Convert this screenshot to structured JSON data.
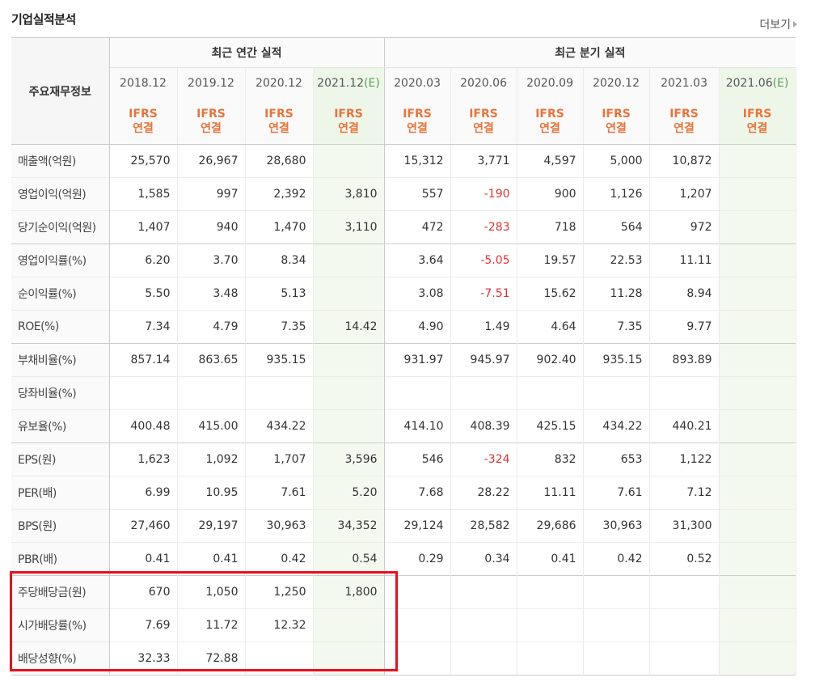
{
  "header": {
    "title": "기업실적분석",
    "more_label": "더보기"
  },
  "table": {
    "corner_label": "주요재무정보",
    "annual_label": "최근 연간 실적",
    "quarterly_label": "최근 분기 실적",
    "periods": [
      {
        "label": "2018.12",
        "e": "",
        "group": "annual",
        "forecast": false
      },
      {
        "label": "2019.12",
        "e": "",
        "group": "annual",
        "forecast": false
      },
      {
        "label": "2020.12",
        "e": "",
        "group": "annual",
        "forecast": false
      },
      {
        "label": "2021.12",
        "e": "(E)",
        "group": "annual",
        "forecast": true
      },
      {
        "label": "2020.03",
        "e": "",
        "group": "quarter",
        "forecast": false
      },
      {
        "label": "2020.06",
        "e": "",
        "group": "quarter",
        "forecast": false
      },
      {
        "label": "2020.09",
        "e": "",
        "group": "quarter",
        "forecast": false
      },
      {
        "label": "2020.12",
        "e": "",
        "group": "quarter",
        "forecast": false
      },
      {
        "label": "2021.03",
        "e": "",
        "group": "quarter",
        "forecast": false
      },
      {
        "label": "2021.06",
        "e": "(E)",
        "group": "quarter",
        "forecast": true
      }
    ],
    "ifrs_line1": "IFRS",
    "ifrs_line2": "연결",
    "rows": [
      {
        "label": "매출액(억원)",
        "values": [
          "25,570",
          "26,967",
          "28,680",
          "",
          "15,312",
          "3,771",
          "4,597",
          "5,000",
          "10,872",
          ""
        ],
        "sep": true
      },
      {
        "label": "영업이익(억원)",
        "values": [
          "1,585",
          "997",
          "2,392",
          "3,810",
          "557",
          "-190",
          "900",
          "1,126",
          "1,207",
          ""
        ]
      },
      {
        "label": "당기순이익(억원)",
        "values": [
          "1,407",
          "940",
          "1,470",
          "3,110",
          "472",
          "-283",
          "718",
          "564",
          "972",
          ""
        ]
      },
      {
        "label": "영업이익률(%)",
        "values": [
          "6.20",
          "3.70",
          "8.34",
          "",
          "3.64",
          "-5.05",
          "19.57",
          "22.53",
          "11.11",
          ""
        ],
        "sep": true
      },
      {
        "label": "순이익률(%)",
        "values": [
          "5.50",
          "3.48",
          "5.13",
          "",
          "3.08",
          "-7.51",
          "15.62",
          "11.28",
          "8.94",
          ""
        ]
      },
      {
        "label": "ROE(%)",
        "values": [
          "7.34",
          "4.79",
          "7.35",
          "14.42",
          "4.90",
          "1.49",
          "4.64",
          "7.35",
          "9.77",
          ""
        ]
      },
      {
        "label": "부채비율(%)",
        "values": [
          "857.14",
          "863.65",
          "935.15",
          "",
          "931.97",
          "945.97",
          "902.40",
          "935.15",
          "893.89",
          ""
        ],
        "sep": true
      },
      {
        "label": "당좌비율(%)",
        "values": [
          "",
          "",
          "",
          "",
          "",
          "",
          "",
          "",
          "",
          ""
        ]
      },
      {
        "label": "유보율(%)",
        "values": [
          "400.48",
          "415.00",
          "434.22",
          "",
          "414.10",
          "408.39",
          "425.15",
          "434.22",
          "440.21",
          ""
        ]
      },
      {
        "label": "EPS(원)",
        "values": [
          "1,623",
          "1,092",
          "1,707",
          "3,596",
          "546",
          "-324",
          "832",
          "653",
          "1,122",
          ""
        ],
        "sep": true
      },
      {
        "label": "PER(배)",
        "values": [
          "6.99",
          "10.95",
          "7.61",
          "5.20",
          "7.68",
          "28.22",
          "11.11",
          "7.61",
          "7.12",
          ""
        ]
      },
      {
        "label": "BPS(원)",
        "values": [
          "27,460",
          "29,197",
          "30,963",
          "34,352",
          "29,124",
          "28,582",
          "29,686",
          "30,963",
          "31,300",
          ""
        ]
      },
      {
        "label": "PBR(배)",
        "values": [
          "0.41",
          "0.41",
          "0.42",
          "0.54",
          "0.29",
          "0.34",
          "0.41",
          "0.42",
          "0.52",
          ""
        ]
      },
      {
        "label": "주당배당금(원)",
        "values": [
          "670",
          "1,050",
          "1,250",
          "1,800",
          "",
          "",
          "",
          "",
          "",
          ""
        ],
        "sep": true
      },
      {
        "label": "시가배당률(%)",
        "values": [
          "7.69",
          "11.72",
          "12.32",
          "",
          "",
          "",
          "",
          "",
          "",
          ""
        ]
      },
      {
        "label": "배당성향(%)",
        "values": [
          "32.33",
          "72.88",
          "",
          "",
          "",
          "",
          "",
          "",
          "",
          ""
        ]
      }
    ]
  },
  "colors": {
    "ifrs": "#e8743a",
    "negative": "#dd3333",
    "highlight": "#e8101e",
    "forecast_bg": "#f4f9f0"
  }
}
